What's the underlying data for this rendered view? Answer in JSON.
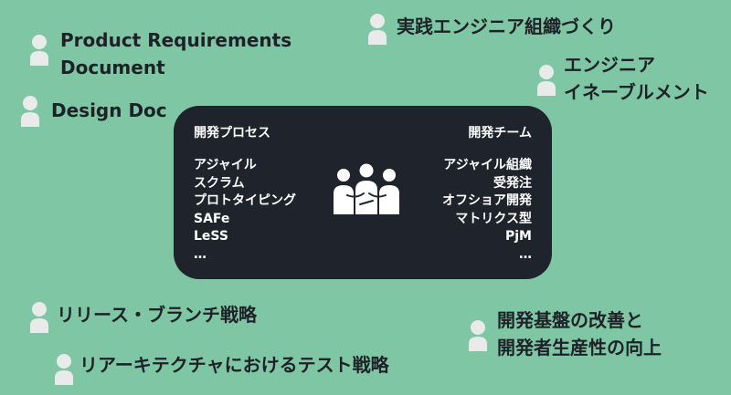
{
  "topics": {
    "product_requirements": [
      "Product Requirements",
      "Document"
    ],
    "design_doc": "Design Doc",
    "practical_org": "実践エンジニア組織づくり",
    "enablement": [
      "エンジニア",
      "イネーブルメント"
    ],
    "release_branch": "リリース・ブランチ戦略",
    "architecture_test": "リアーキテクチャにおけるテスト戦略",
    "dev_foundation": [
      "開発基盤の改善と",
      "開発者生産性の向上"
    ]
  },
  "board": {
    "left_title": "開発プロセス",
    "left_items": [
      "アジャイル",
      "スクラム",
      "プロトタイピング",
      "SAFe",
      "LeSS",
      "…"
    ],
    "right_title": "開発チーム",
    "right_items": [
      "アジャイル組織",
      "受発注",
      "オフショア開発",
      "マトリクス型",
      "PjM",
      "…"
    ]
  },
  "icons": {
    "topic_person": "person-icon",
    "team": "team-icon"
  },
  "colors": {
    "background": "#7fc6a4",
    "panel": "#1f232c",
    "person_icon": "#e8ebe9",
    "text_dark": "#1e2128",
    "text_light": "#ffffff"
  }
}
